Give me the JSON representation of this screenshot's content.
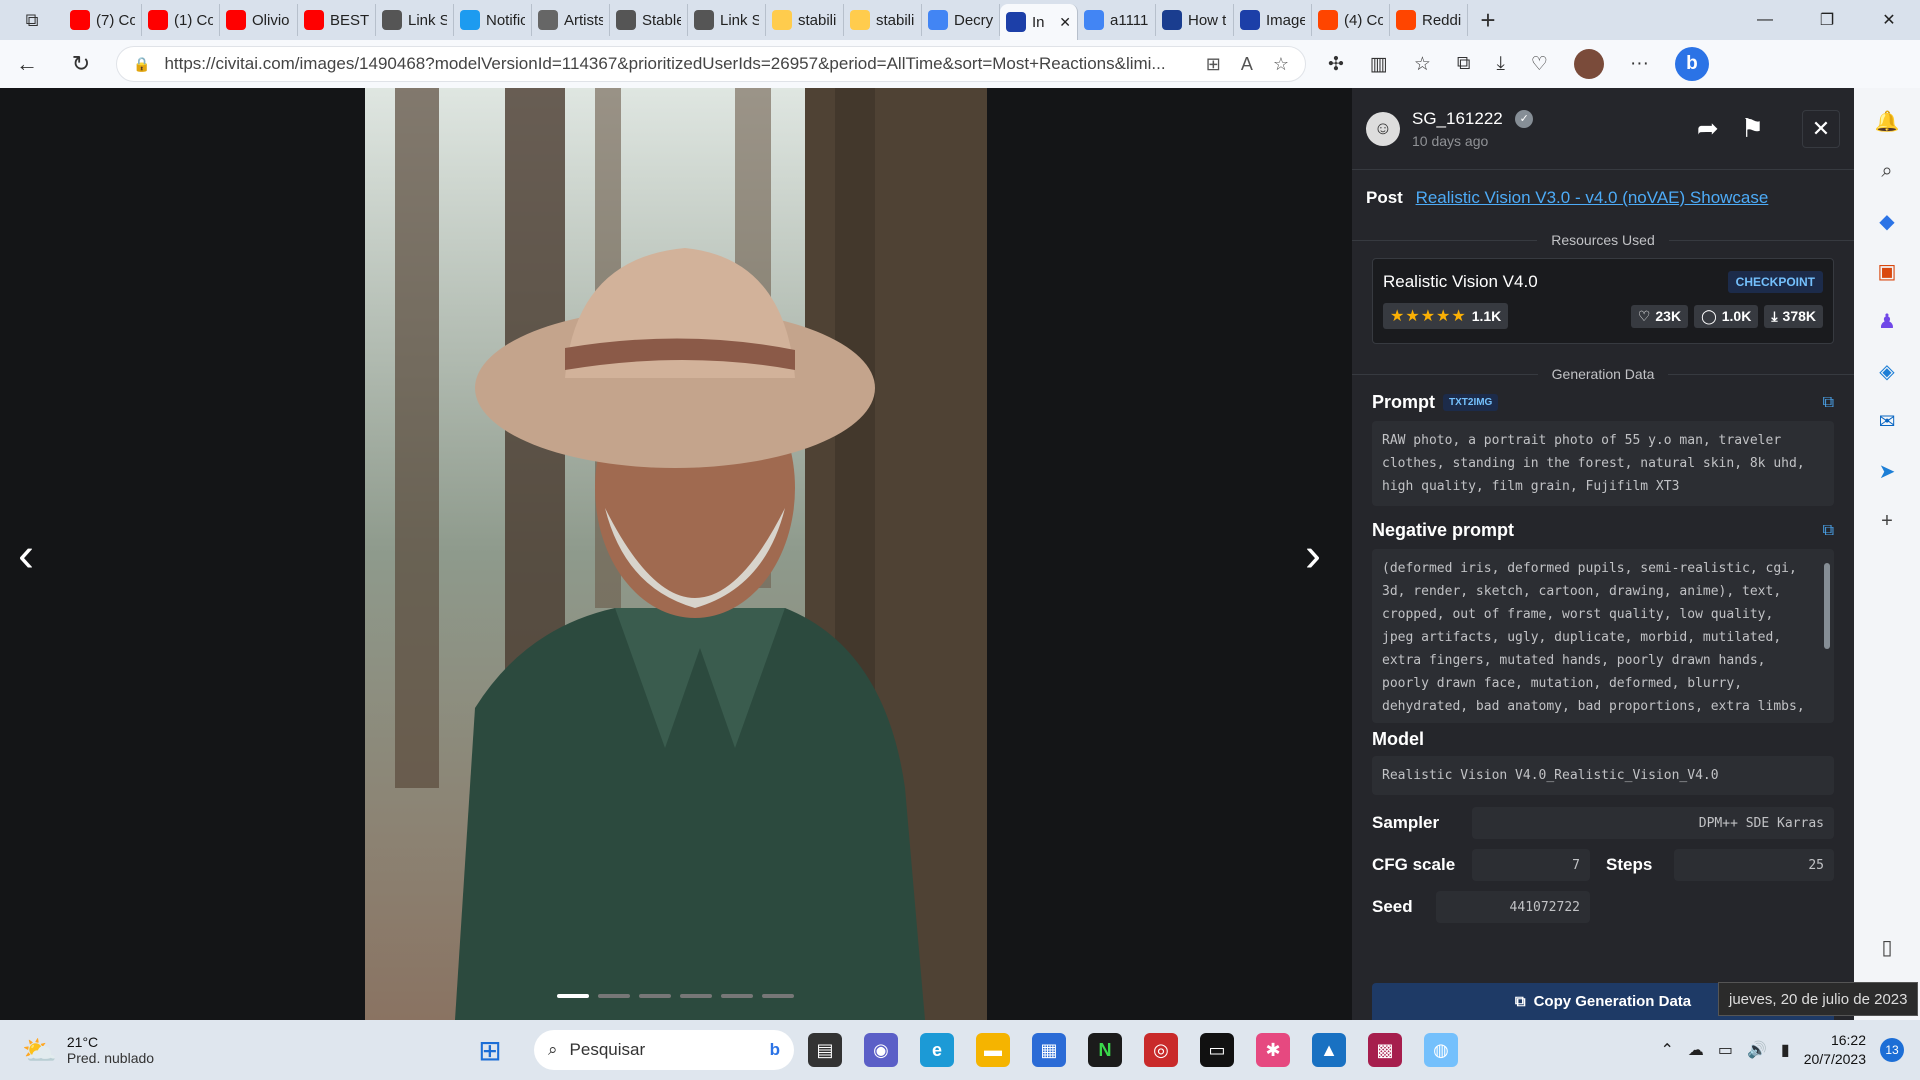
{
  "browser": {
    "tabs": [
      {
        "title": "(7) Co",
        "icon": "youtube-icon",
        "color": "#ff0000"
      },
      {
        "title": "(1) Co",
        "icon": "youtube-icon",
        "color": "#ff0000"
      },
      {
        "title": "Olivio",
        "icon": "youtube-icon",
        "color": "#ff0000"
      },
      {
        "title": "BEST /",
        "icon": "youtube-icon",
        "color": "#ff0000"
      },
      {
        "title": "Link Si",
        "icon": "document-icon",
        "color": "#555555"
      },
      {
        "title": "Notific",
        "icon": "twitter-icon",
        "color": "#1d9bf0"
      },
      {
        "title": "Artists",
        "icon": "grid-icon",
        "color": "#666666"
      },
      {
        "title": "Stable",
        "icon": "document-icon",
        "color": "#555555"
      },
      {
        "title": "Link Si",
        "icon": "document-icon",
        "color": "#555555"
      },
      {
        "title": "stabili",
        "icon": "huggingface-icon",
        "color": "#ffcc4d"
      },
      {
        "title": "stabili",
        "icon": "huggingface-icon",
        "color": "#ffcc4d"
      },
      {
        "title": "Decry",
        "icon": "docs-icon",
        "color": "#4285f4"
      },
      {
        "title": "In",
        "icon": "civitai-icon",
        "color": "#1c3fa8",
        "active": true
      },
      {
        "title": "a1111",
        "icon": "google-icon",
        "color": "#4285f4"
      },
      {
        "title": "How t",
        "icon": "h-icon",
        "color": "#1a3d8f"
      },
      {
        "title": "Image",
        "icon": "civitai-icon",
        "color": "#1c3fa8"
      },
      {
        "title": "(4) Co",
        "icon": "reddit-icon",
        "color": "#ff4500"
      },
      {
        "title": "Reddi",
        "icon": "reddit-icon",
        "color": "#ff4500"
      }
    ],
    "url": "https://civitai.com/images/1490468?modelVersionId=114367&prioritizedUserIds=26957&period=AllTime&sort=Most+Reactions&limi..."
  },
  "viewer": {
    "dots_total": 6,
    "dots_active": 0
  },
  "panel": {
    "user": {
      "name": "SG_161222",
      "posted": "10 days ago"
    },
    "post": {
      "label": "Post",
      "link": "Realistic Vision V3.0 - v4.0 (noVAE) Showcase"
    },
    "resources_label": "Resources Used",
    "resource": {
      "name": "Realistic Vision V4.0",
      "type": "CHECKPOINT",
      "stars": "★★★★★",
      "rating_count": "1.1K",
      "likes": "23K",
      "comments": "1.0K",
      "downloads": "378K"
    },
    "gen_label": "Generation Data",
    "prompt": {
      "label": "Prompt",
      "tag": "TXT2IMG",
      "text": "RAW photo, a portrait photo of 55 y.o man, traveler clothes, standing in the forest, natural skin, 8k uhd, high quality, film grain, Fujifilm XT3"
    },
    "negative": {
      "label": "Negative prompt",
      "text": "(deformed iris, deformed pupils, semi-realistic, cgi, 3d, render, sketch, cartoon, drawing, anime), text, cropped, out of frame, worst quality, low quality, jpeg artifacts, ugly, duplicate, morbid, mutilated, extra fingers, mutated hands, poorly drawn hands, poorly drawn face, mutation, deformed, blurry, dehydrated, bad anatomy, bad proportions, extra limbs, cloned face, disfigured"
    },
    "model": {
      "label": "Model",
      "value": "Realistic Vision V4.0_Realistic_Vision_V4.0"
    },
    "sampler": {
      "label": "Sampler",
      "value": "DPM++ SDE Karras"
    },
    "cfg": {
      "label": "CFG scale",
      "value": "7"
    },
    "steps": {
      "label": "Steps",
      "value": "25"
    },
    "seed": {
      "label": "Seed",
      "value": "441072722"
    },
    "copy_button": "Copy Generation Data"
  },
  "taskbar": {
    "weather": {
      "temp": "21°C",
      "desc": "Pred. nublado"
    },
    "search_placeholder": "Pesquisar",
    "time": "16:22",
    "date": "20/7/2023",
    "notifications": "13",
    "tooltip": "jueves, 20 de julio de 2023"
  }
}
